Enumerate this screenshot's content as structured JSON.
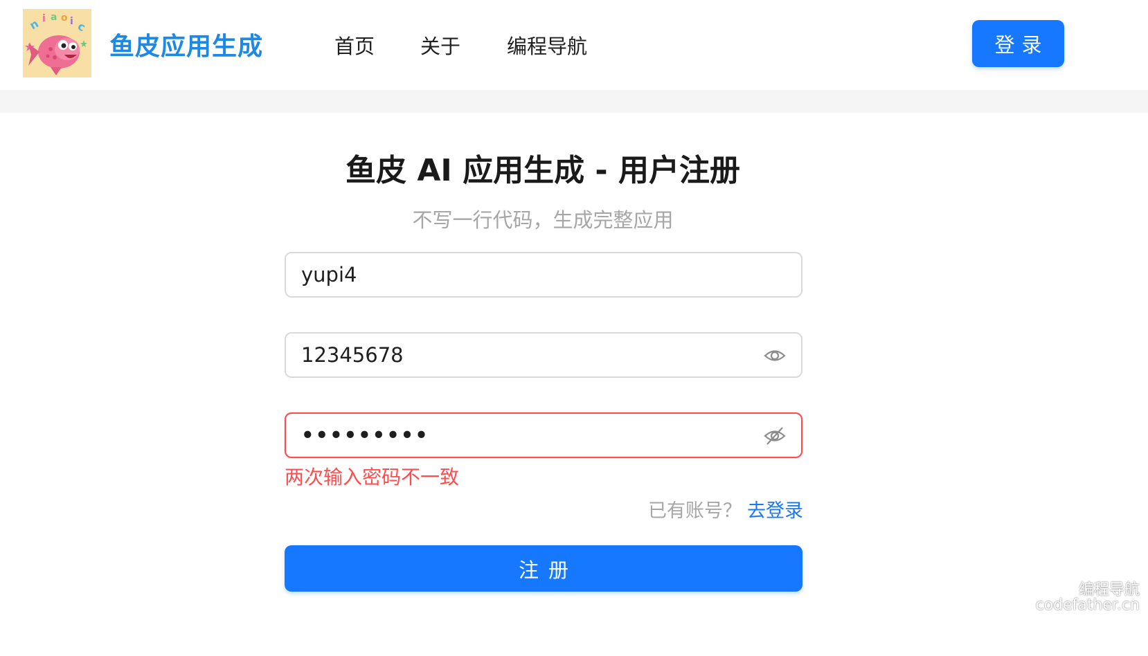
{
  "header": {
    "brand_name": "鱼皮应用生成",
    "nav": [
      {
        "label": "首页"
      },
      {
        "label": "关于"
      },
      {
        "label": "编程导航"
      }
    ],
    "login_label": "登录"
  },
  "register": {
    "title": "鱼皮 AI 应用生成 - 用户注册",
    "subtitle": "不写一行代码，生成完整应用",
    "username_value": "yupi4",
    "password_value": "12345678",
    "confirm_value": "•••••••••",
    "error_text": "两次输入密码不一致",
    "has_account_text": "已有账号？",
    "goto_login_label": "去登录",
    "submit_label": "注册"
  },
  "watermark": {
    "line1": "编程导航",
    "line2": "codefather.cn"
  },
  "colors": {
    "primary": "#1677ff",
    "brand": "#1e88e5",
    "error": "#ff4d4f",
    "muted": "#a6a6a6"
  },
  "icons": [
    "fish-logo",
    "eye-icon",
    "eye-off-icon"
  ]
}
